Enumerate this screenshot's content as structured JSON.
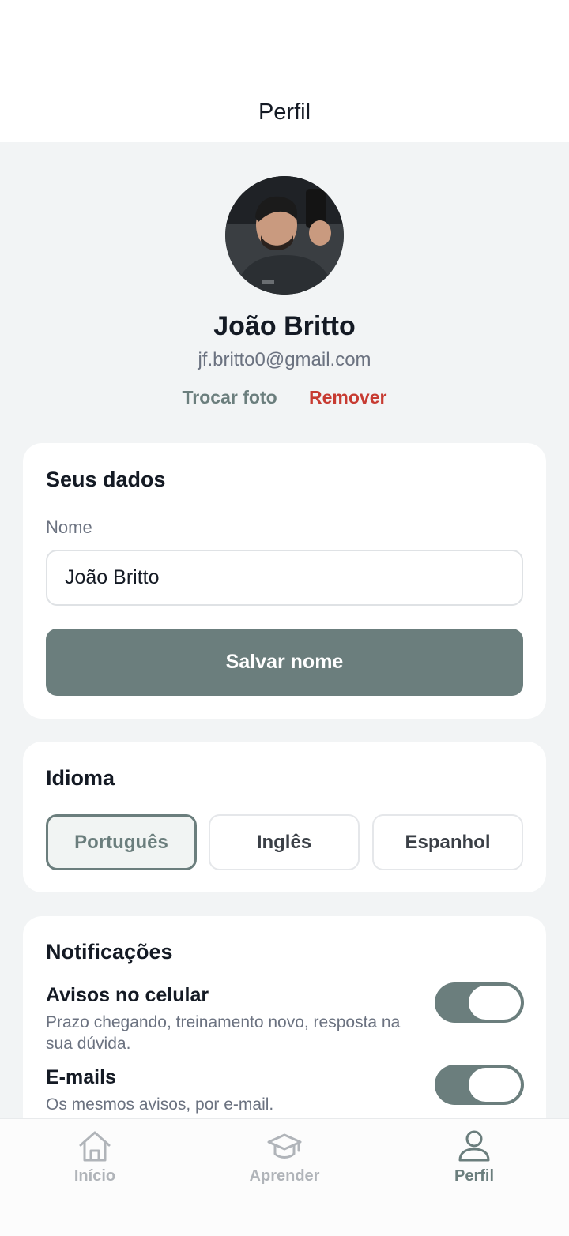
{
  "header": {
    "title": "Perfil"
  },
  "profile": {
    "name": "João Britto",
    "email": "jf.britto0@gmail.com",
    "change_photo_label": "Trocar foto",
    "remove_photo_label": "Remover"
  },
  "personal_data": {
    "title": "Seus dados",
    "name_label": "Nome",
    "name_value": "João Britto",
    "save_label": "Salvar nome"
  },
  "language": {
    "title": "Idioma",
    "options": [
      "Português",
      "Inglês",
      "Espanhol"
    ],
    "selected": "Português"
  },
  "notifications": {
    "title": "Notificações",
    "items": [
      {
        "title": "Avisos no celular",
        "description": "Prazo chegando, treinamento novo, resposta na sua dúvida.",
        "enabled": true
      },
      {
        "title": "E-mails",
        "description": "Os mesmos avisos, por e-mail.",
        "enabled": true
      }
    ]
  },
  "tabbar": {
    "items": [
      {
        "label": "Início",
        "icon": "home-icon"
      },
      {
        "label": "Aprender",
        "icon": "graduation-cap-icon"
      },
      {
        "label": "Perfil",
        "icon": "user-icon"
      }
    ],
    "active": "Perfil"
  },
  "colors": {
    "accent": "#6b7e7d",
    "danger": "#c73b32",
    "background": "#f2f4f5",
    "card": "#ffffff"
  }
}
